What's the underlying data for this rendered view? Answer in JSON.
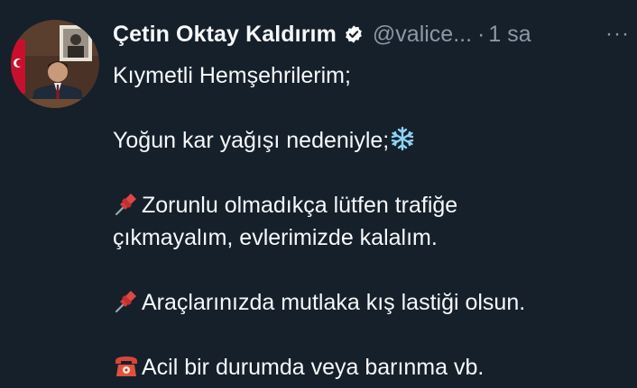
{
  "author": {
    "display_name": "Çetin Oktay Kaldırım",
    "handle": "@valice...",
    "separator": "·",
    "time": "1 sa",
    "verified_icon": "verified-badge-icon",
    "more_label": "···"
  },
  "tweet": {
    "line1": "Kıymetli Hemşehrilerim;",
    "line2": "Yoğun kar yağışı nedeniyle;",
    "line2_emoji": "snowflake-icon",
    "line3a": "Zorunlu olmadıkça lütfen trafiğe",
    "line3b": "çıkmayalım, evlerimizde kalalım.",
    "line3_emoji": "pushpin-icon",
    "line4": "Araçlarınızda mutlaka kış lastiği olsun.",
    "line4_emoji": "pushpin-icon",
    "line5": "Acil bir durumda veya barınma vb.",
    "line5_emoji": "telephone-icon"
  },
  "colors": {
    "background": "#15202b",
    "text": "#f7f9f9",
    "muted": "#8b98a5",
    "verified": "#ffffff"
  }
}
